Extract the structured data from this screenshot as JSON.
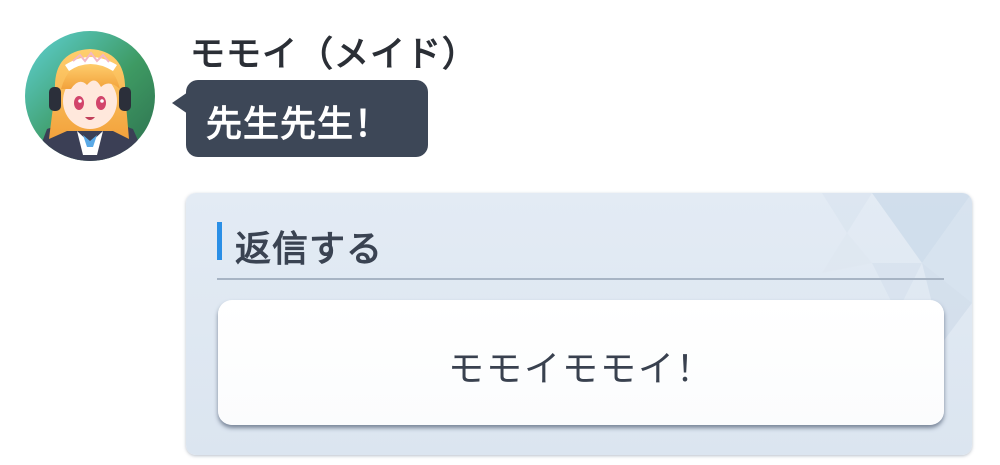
{
  "message": {
    "sender_name": "モモイ（メイド）",
    "avatar_icon": "character-portrait-icon",
    "text": "先生先生！",
    "bubble_color": "#3d4757"
  },
  "reply": {
    "title": "返信する",
    "accent_color": "#2a8fe6",
    "options": [
      {
        "label": "モモイモモイ！"
      }
    ]
  }
}
